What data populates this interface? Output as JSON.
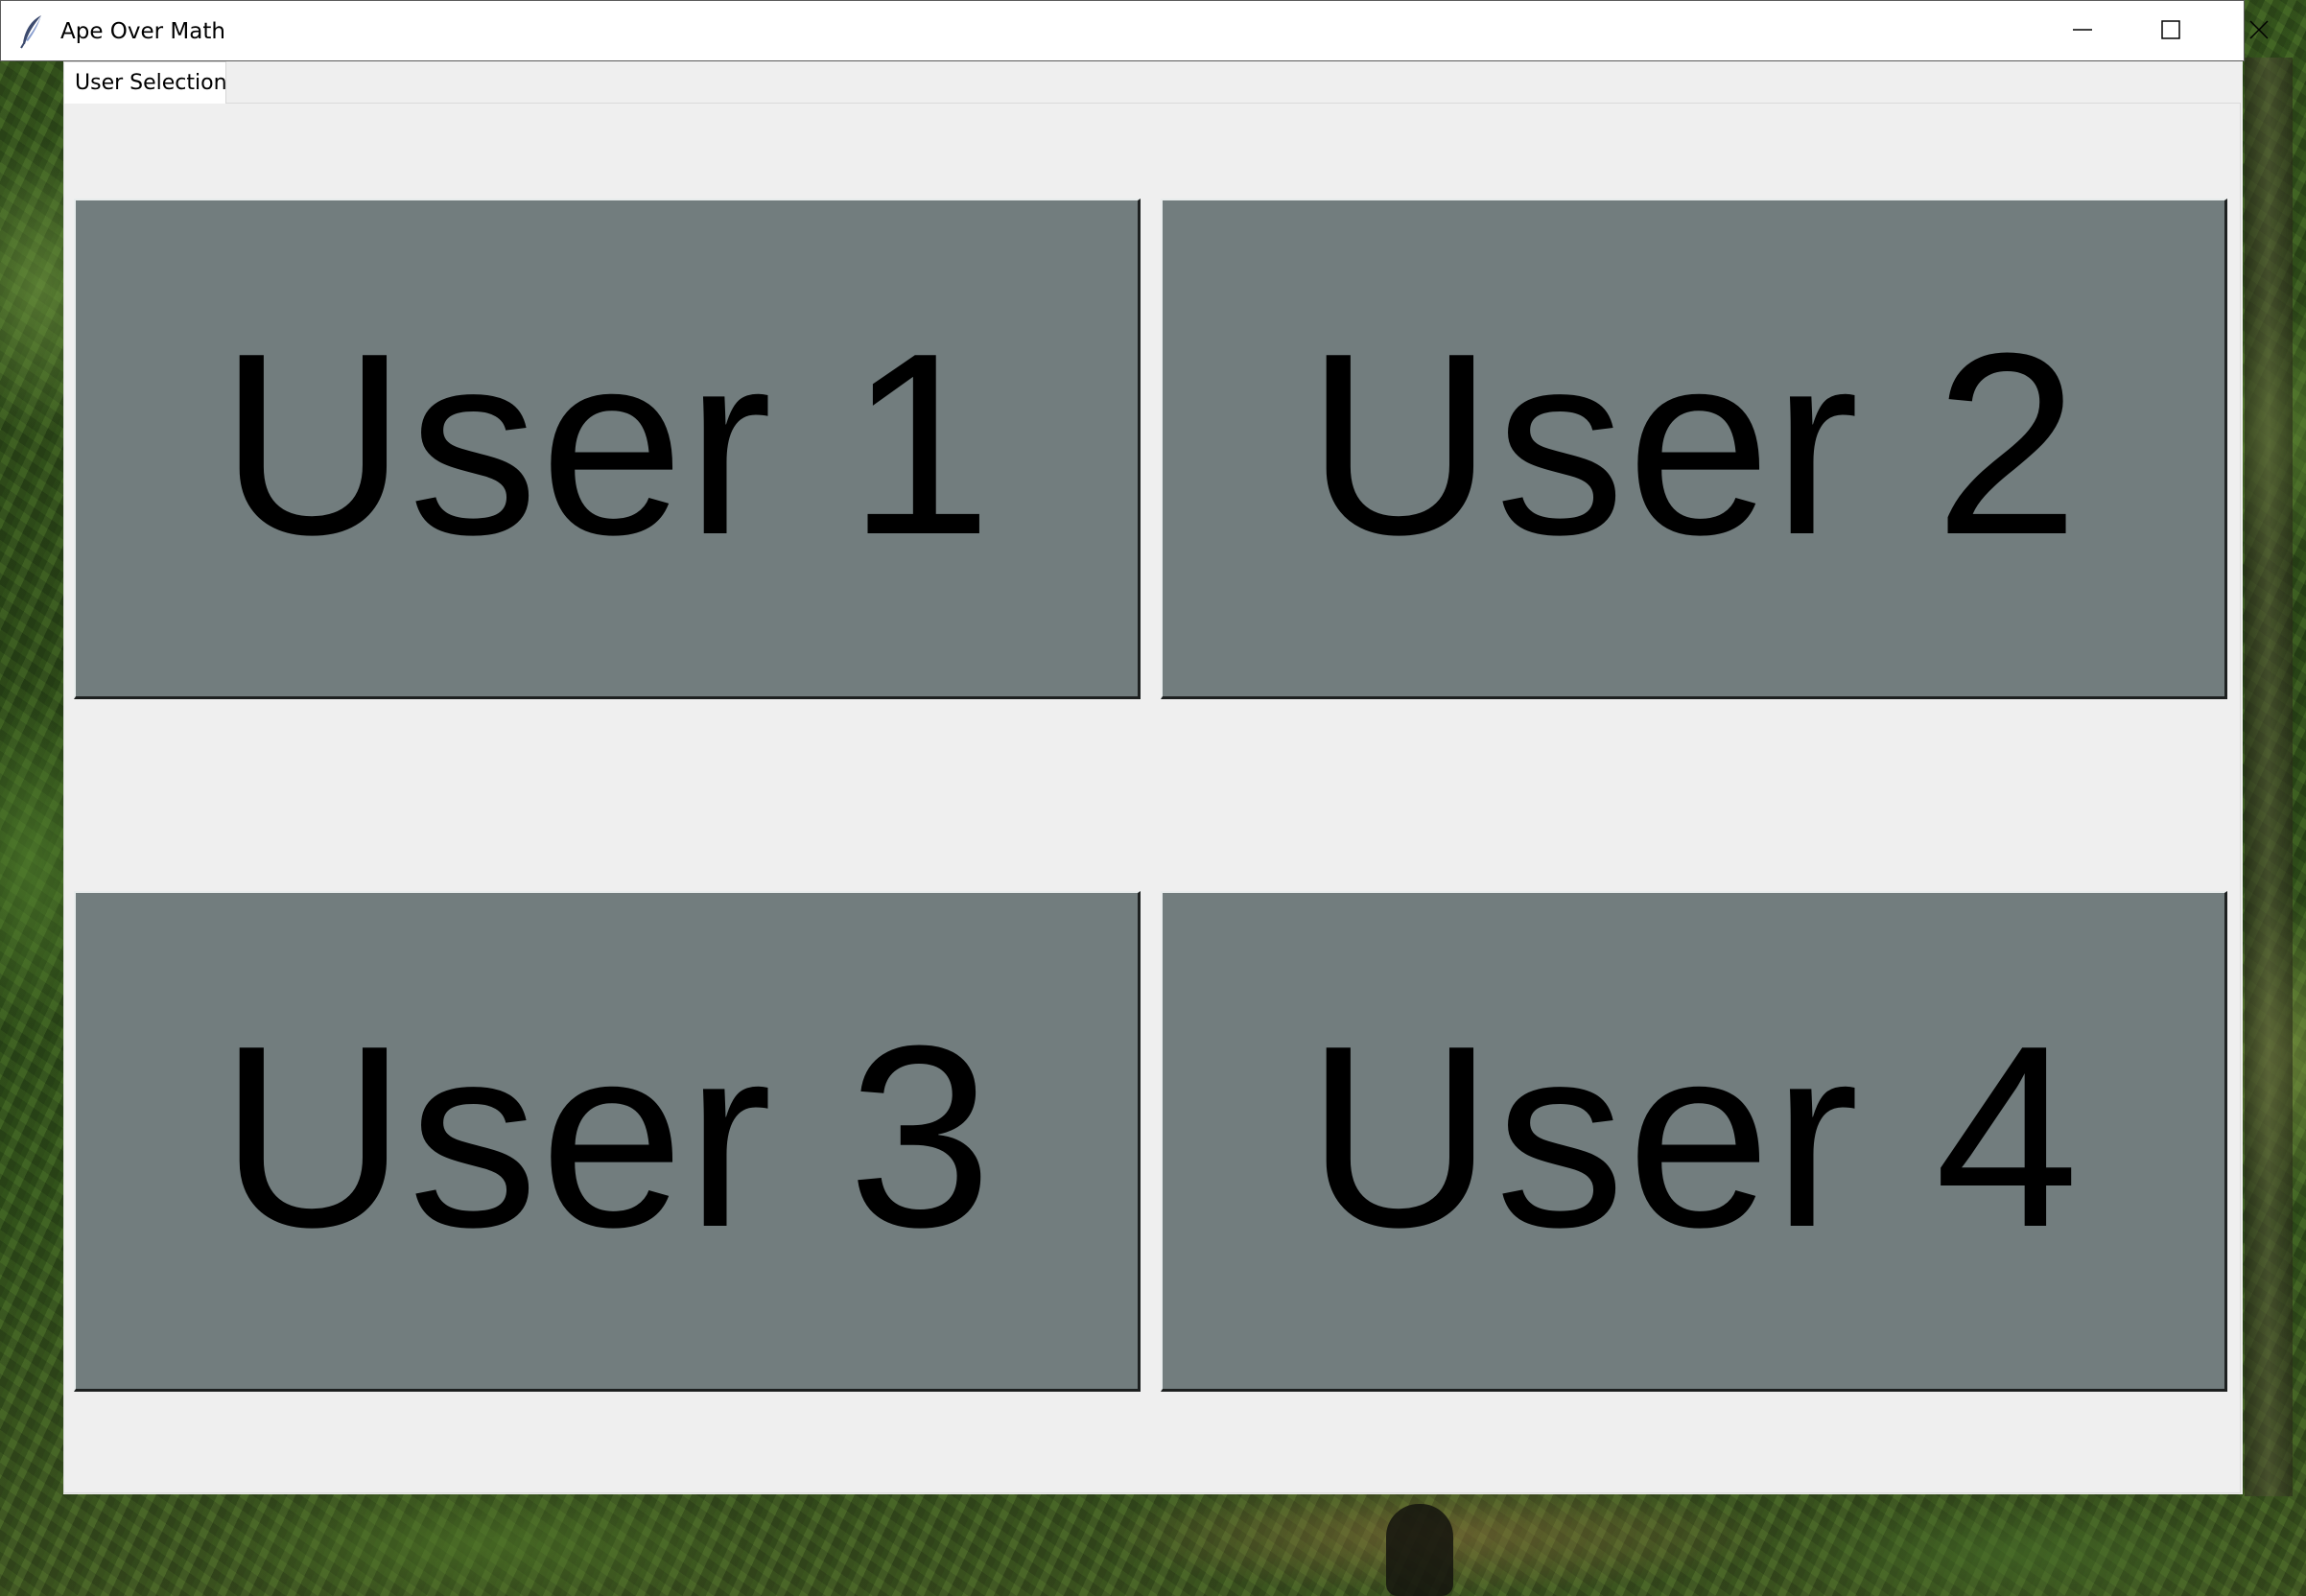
{
  "window": {
    "title": "Ape Over Math",
    "icon": "feather-icon",
    "controls": {
      "minimize_icon": "minimize-icon",
      "maximize_icon": "maximize-icon",
      "close_icon": "close-icon"
    }
  },
  "tabs": [
    {
      "label": "User Selection",
      "selected": true
    }
  ],
  "users": [
    {
      "label": "User 1"
    },
    {
      "label": "User 2"
    },
    {
      "label": "User 3"
    },
    {
      "label": "User 4"
    }
  ],
  "colors": {
    "button_fill": "#727d7e",
    "panel_background": "#efefef",
    "text": "#000000"
  }
}
